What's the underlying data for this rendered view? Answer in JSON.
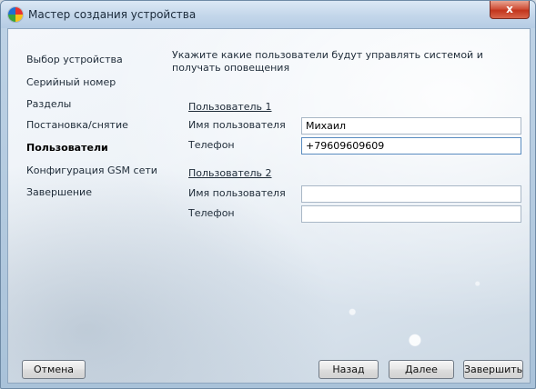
{
  "window": {
    "title": "Мастер создания устройства",
    "close_label": "x"
  },
  "sidebar": {
    "items": [
      {
        "label": "Выбор устройства"
      },
      {
        "label": "Серийный номер"
      },
      {
        "label": "Разделы"
      },
      {
        "label": "Постановка/снятие"
      },
      {
        "label": "Пользователи",
        "active": true
      },
      {
        "label": "Конфигурация GSM сети"
      },
      {
        "label": "Завершение"
      }
    ]
  },
  "main": {
    "instruction": "Укажите какие пользователи будут управлять системой и получать оповещения",
    "users": [
      {
        "heading": "Пользователь 1",
        "name_label": "Имя пользователя",
        "name_value": "Михаил",
        "phone_label": "Телефон",
        "phone_value": "+79609609609"
      },
      {
        "heading": "Пользователь 2",
        "name_label": "Имя пользователя",
        "name_value": "",
        "phone_label": "Телефон",
        "phone_value": ""
      }
    ]
  },
  "buttons": {
    "cancel": "Отмена",
    "back": "Назад",
    "next": "Далее",
    "finish": "Завершить"
  },
  "colors": {
    "close_button": "#c9452b",
    "focus_border": "#5a8cc0"
  }
}
